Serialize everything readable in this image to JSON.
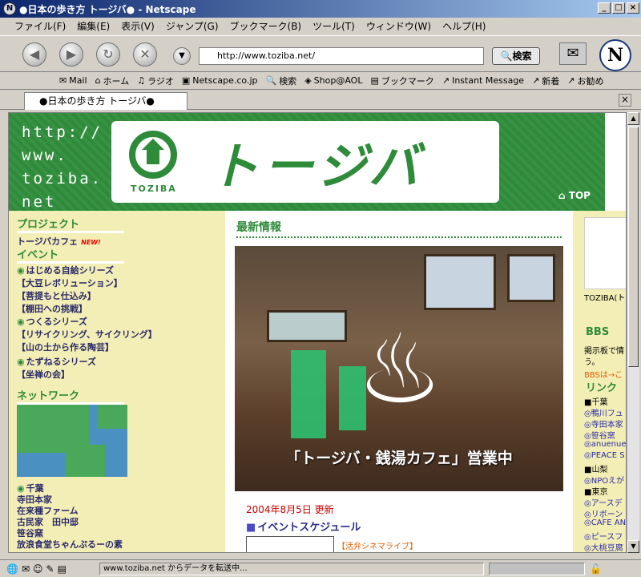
{
  "window": {
    "title": "●日本の歩き方 トージバ● - Netscape",
    "app_icon": "N"
  },
  "menu": [
    "ファイル(F)",
    "編集(E)",
    "表示(V)",
    "ジャンプ(G)",
    "ブックマーク(B)",
    "ツール(T)",
    "ウィンドウ(W)",
    "ヘルプ(H)"
  ],
  "nav": {
    "url": "http://www.toziba.net/",
    "search_label": "検索"
  },
  "personal_toolbar": [
    "Mail",
    "ホーム",
    "ラジオ",
    "Netscape.co.jp",
    "検索",
    "Shop@AOL",
    "ブックマーク",
    "Instant Message",
    "新着",
    "お勧め"
  ],
  "tab": {
    "title": "●日本の歩き方 トージバ●"
  },
  "page": {
    "banner_url": "http://\nwww.\ntoziba.\nnet",
    "logo_title": "トージバ",
    "logo_sub": "TOZIBA",
    "top_link": "TOP",
    "left": {
      "project_head": "プロジェクト",
      "cafe": "トージバカフェ",
      "new_badge": "NEW!",
      "event_head": "イベント",
      "events": [
        "はじめる自給シリーズ",
        "【大豆レボリューション】",
        "【菩提もと仕込み】",
        "【棚田への挑戦】",
        "つくるシリーズ",
        "【リサイクリング、サイクリング】",
        "【山の土から作る陶芸】",
        "たずねるシリーズ",
        "【坐禅の会】"
      ],
      "network_head": "ネットワーク",
      "network": [
        "千葉",
        "寺田本家",
        "在来種ファーム",
        "古民家　田中邸",
        "笹谷窯",
        "放浪食堂ちゃんぷるーの素"
      ]
    },
    "main": {
      "news_head": "最新情報",
      "photo_caption": "「トージバ・銭湯カフェ」営業中",
      "date": "2004年8月5日 更新",
      "event_schedule": "イベントスケジュール",
      "cinema_link": "【活弁シネマライブ】"
    },
    "right": {
      "thumb_caption": "TOZIBA(トー",
      "bbs_head": "BBS",
      "bbs_text": [
        "掲示板で情",
        "う。"
      ],
      "bbs_link": "BBSは→こ",
      "link_head": "リンク",
      "links": [
        "■千葉",
        "◎鴨川フュ",
        "◎寺田本家",
        "◎笹谷窯",
        "◎anuenue",
        "◎PEACE S",
        "■山梨",
        "◎NPOえが",
        "■東京",
        "◎アースデ",
        "◎リボーン",
        "◎CAFE AN",
        "◎ピースフ",
        "◎大桃豆腐"
      ]
    }
  },
  "status": {
    "text": "www.toziba.net からデータを転送中..."
  }
}
